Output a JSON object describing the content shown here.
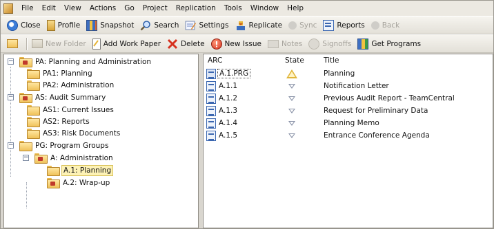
{
  "menu": [
    "File",
    "Edit",
    "View",
    "Actions",
    "Go",
    "Project",
    "Replication",
    "Tools",
    "Window",
    "Help"
  ],
  "toolbar1": [
    {
      "label": "Close",
      "icon": "close-icon",
      "disabled": false
    },
    {
      "label": "Profile",
      "icon": "profile-icon",
      "disabled": false
    },
    {
      "label": "Snapshot",
      "icon": "snapshot-icon",
      "disabled": false
    },
    {
      "label": "Search",
      "icon": "search-icon",
      "disabled": false
    },
    {
      "label": "Settings",
      "icon": "settings-icon",
      "disabled": false
    },
    {
      "label": "Replicate",
      "icon": "replicate-icon",
      "disabled": false
    },
    {
      "label": "Sync",
      "icon": "sync-icon",
      "disabled": true
    },
    {
      "label": "Reports",
      "icon": "reports-icon",
      "disabled": false
    },
    {
      "label": "Back",
      "icon": "back-icon",
      "disabled": true
    }
  ],
  "toolbar2": [
    {
      "label": "",
      "icon": "folder-up-icon",
      "disabled": false
    },
    {
      "label": "New Folder",
      "icon": "new-folder-icon",
      "disabled": true
    },
    {
      "label": "Add Work Paper",
      "icon": "add-work-paper-icon",
      "disabled": false
    },
    {
      "label": "Delete",
      "icon": "delete-icon",
      "disabled": false
    },
    {
      "label": "New Issue",
      "icon": "new-issue-icon",
      "disabled": false
    },
    {
      "label": "Notes",
      "icon": "notes-icon",
      "disabled": true
    },
    {
      "label": "Signoffs",
      "icon": "signoffs-icon",
      "disabled": true
    },
    {
      "label": "Get Programs",
      "icon": "get-programs-icon",
      "disabled": false
    }
  ],
  "tree": [
    {
      "label": "PA: Planning and Administration",
      "level": 0,
      "expander": "−",
      "folder": "red"
    },
    {
      "label": "PA1: Planning",
      "level": 1,
      "expander": "",
      "folder": "plain"
    },
    {
      "label": "PA2: Administration",
      "level": 1,
      "expander": "",
      "folder": "plain"
    },
    {
      "label": "AS: Audit Summary",
      "level": 0,
      "expander": "−",
      "folder": "red"
    },
    {
      "label": "AS1: Current Issues",
      "level": 1,
      "expander": "",
      "folder": "plain"
    },
    {
      "label": "AS2: Reports",
      "level": 1,
      "expander": "",
      "folder": "plain"
    },
    {
      "label": "AS3: Risk Documents",
      "level": 1,
      "expander": "",
      "folder": "plain"
    },
    {
      "label": "PG: Program Groups",
      "level": 0,
      "expander": "−",
      "folder": "plain"
    },
    {
      "label": "A: Administration",
      "level": 1,
      "expander": "−",
      "folder": "red"
    },
    {
      "label": "A.1: Planning",
      "level": 2,
      "expander": "",
      "folder": "plain",
      "selected": true
    },
    {
      "label": "A.2: Wrap-up",
      "level": 2,
      "expander": "",
      "folder": "red"
    }
  ],
  "list": {
    "columns": [
      "ARC",
      "State",
      "Title"
    ],
    "rows": [
      {
        "arc": "A.1.PRG",
        "state": "warning",
        "title": "Planning",
        "focused": true
      },
      {
        "arc": "A.1.1",
        "state": "pending",
        "title": "Notification Letter"
      },
      {
        "arc": "A.1.2",
        "state": "pending",
        "title": "Previous Audit Report - TeamCentral"
      },
      {
        "arc": "A.1.3",
        "state": "pending",
        "title": "Request for Preliminary Data"
      },
      {
        "arc": "A.1.4",
        "state": "pending",
        "title": "Planning Memo"
      },
      {
        "arc": "A.1.5",
        "state": "pending",
        "title": "Entrance Conference Agenda"
      }
    ]
  }
}
